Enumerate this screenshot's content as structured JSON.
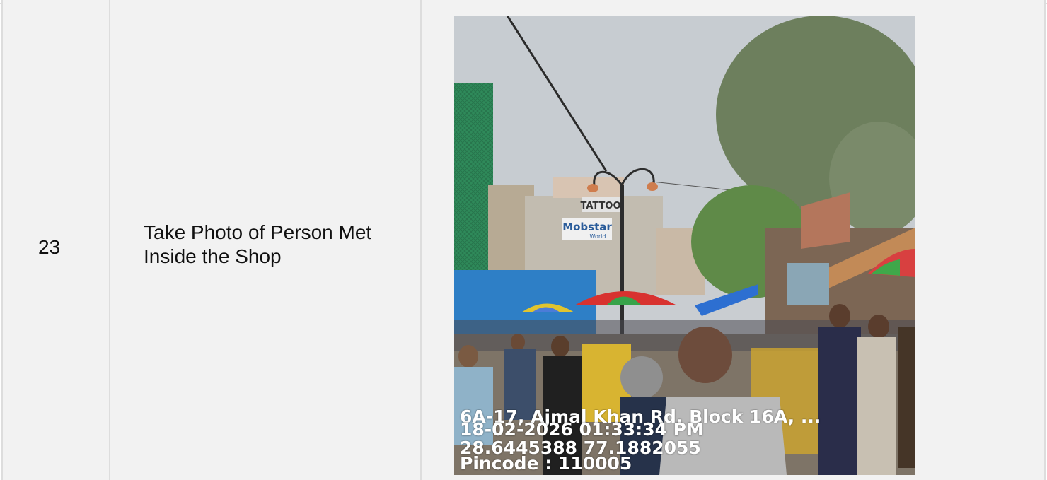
{
  "row": {
    "number": "23",
    "label": "Take Photo of Person Met Inside the Shop"
  },
  "photo": {
    "signs": {
      "tattoo": "TATTOO",
      "shop": "Mobstar",
      "shop_sub": "World"
    },
    "stamp": {
      "address": "6A-17, Ajmal Khan Rd, Block 16A, ...",
      "datetime": "18-02-2026 01:33:34 PM",
      "coordinates": "28.6445388 77.1882055",
      "pincode": "Pincode : 110005"
    }
  },
  "colors": {
    "cell_background": "#f2f2f2",
    "border": "#dddddd",
    "text": "#111111"
  }
}
